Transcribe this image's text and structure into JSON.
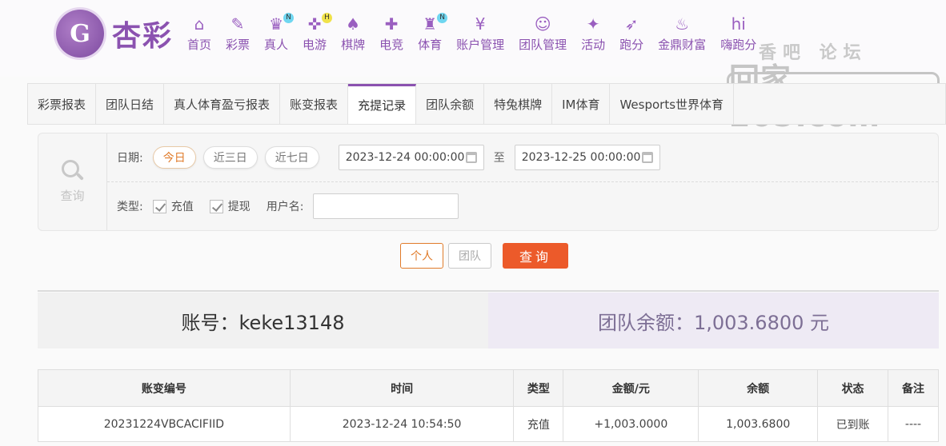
{
  "header": {
    "logo_glyph": "G",
    "logo_text": "杏彩",
    "nav": [
      {
        "label": "首页",
        "icon": "home-icon",
        "glyph": "⌂",
        "badge": ""
      },
      {
        "label": "彩票",
        "icon": "ticket-icon",
        "glyph": "✎",
        "badge": ""
      },
      {
        "label": "真人",
        "icon": "dealer-icon",
        "glyph": "♛",
        "badge": "N"
      },
      {
        "label": "电游",
        "icon": "gamepad-icon",
        "glyph": "✜",
        "badge": "H"
      },
      {
        "label": "棋牌",
        "icon": "cards-icon",
        "glyph": "♠",
        "badge": ""
      },
      {
        "label": "电竞",
        "icon": "esports-controller-icon",
        "glyph": "✚",
        "badge": ""
      },
      {
        "label": "体育",
        "icon": "trophy-icon",
        "glyph": "♜",
        "badge": "N"
      },
      {
        "label": "账户管理",
        "icon": "yen-coin-icon",
        "glyph": "¥",
        "badge": ""
      },
      {
        "label": "团队管理",
        "icon": "team-icon",
        "glyph": "☺",
        "badge": ""
      },
      {
        "label": "活动",
        "icon": "gift-icon",
        "glyph": "✦",
        "badge": ""
      },
      {
        "label": "跑分",
        "icon": "running-icon",
        "glyph": "➶",
        "badge": ""
      },
      {
        "label": "金鼎财富",
        "icon": "cauldron-icon",
        "glyph": "♨",
        "badge": ""
      },
      {
        "label": "嗨跑分",
        "icon": "hi-icon",
        "glyph": "hi",
        "badge": ""
      }
    ]
  },
  "watermark": {
    "top": "香吧  论坛",
    "main": "回家205.com"
  },
  "tabs": [
    {
      "label": "彩票报表",
      "active": false
    },
    {
      "label": "团队日结",
      "active": false
    },
    {
      "label": "真人体育盈亏报表",
      "active": false
    },
    {
      "label": "账变报表",
      "active": false
    },
    {
      "label": "充提记录",
      "active": true
    },
    {
      "label": "团队余额",
      "active": false
    },
    {
      "label": "特兔棋牌",
      "active": false
    },
    {
      "label": "IM体育",
      "active": false
    },
    {
      "label": "Wesports世界体育",
      "active": false
    }
  ],
  "filter": {
    "query_label": "查询",
    "date_label": "日期:",
    "quick": [
      "今日",
      "近三日",
      "近七日"
    ],
    "start": "2023-12-24 00:00:00",
    "to": "至",
    "end": "2023-12-25 00:00:00",
    "type_label": "类型:",
    "types": [
      "充值",
      "提现"
    ],
    "username_label": "用户名:",
    "username_value": ""
  },
  "buttons": {
    "personal": "个人",
    "team": "团队",
    "query": "查询"
  },
  "summary": {
    "account": "账号：keke13148",
    "team_balance": "团队余额：1,003.6800 元"
  },
  "table": {
    "headers": [
      "账变编号",
      "时间",
      "类型",
      "金额/元",
      "余额",
      "状态",
      "备注"
    ],
    "rows": [
      [
        "20231224VBCACIFIID",
        "2023-12-24 10:54:50",
        "充值",
        "+1,003.0000",
        "1,003.6800",
        "已到账",
        "----"
      ]
    ]
  },
  "colors": {
    "brand": "#8b52b0",
    "accent": "#ec5a2a",
    "success": "#3ea520"
  }
}
